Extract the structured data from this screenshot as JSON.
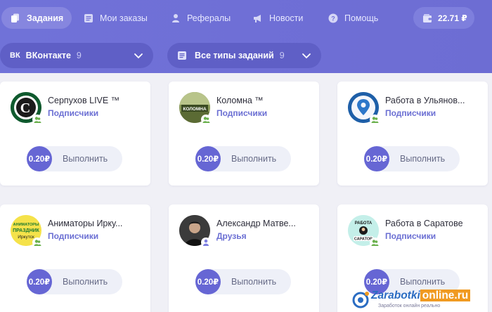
{
  "nav": {
    "tasks": "Задания",
    "orders": "Мои заказы",
    "referrals": "Рефералы",
    "news": "Новости",
    "help": "Помощь"
  },
  "balance": "22.71 ₽",
  "filters": {
    "network": {
      "label": "ВКонтакте",
      "count": "9"
    },
    "task_types": {
      "label": "Все типы заданий",
      "count": "9"
    }
  },
  "cards": [
    {
      "title": "Серпухов LIVE ™",
      "type": "Подписчики",
      "price": "0.20₽",
      "action": "Выполнить"
    },
    {
      "title": "Коломна ™",
      "type": "Подписчики",
      "price": "0.20₽",
      "action": "Выполнить"
    },
    {
      "title": "Работа в Ульянов...",
      "type": "Подписчики",
      "price": "0.20₽",
      "action": "Выполнить"
    },
    {
      "title": "Аниматоры Ирку...",
      "type": "Подписчики",
      "price": "0.20₽",
      "action": "Выполнить"
    },
    {
      "title": "Александр Матве...",
      "type": "Друзья",
      "price": "0.20₽",
      "action": "Выполнить"
    },
    {
      "title": "Работа в Саратове",
      "type": "Подписчики",
      "price": "0.20₽",
      "action": "Выполнить"
    }
  ],
  "avatars": {
    "serpukhov": "С",
    "kolomna": "КОЛОМНА",
    "animators_top": "АНИМАТОРЫ",
    "animators_mid": "ПРАЗДНИК",
    "animators_bot": "Иркутск",
    "saratov_top": "РАБОТА",
    "saratov_bot": "САРАТОВ"
  },
  "watermark": {
    "main": "Zarabotki",
    "tld": "online.ru",
    "sub": "Заработок онлайн реально"
  },
  "colors": {
    "accent": "#6f6fd6",
    "link": "#6b6fd3",
    "price": "#6666d4"
  }
}
